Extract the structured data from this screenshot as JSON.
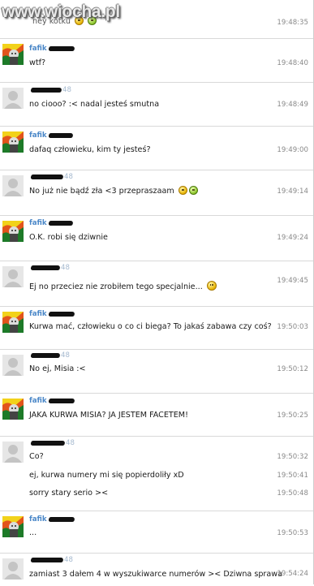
{
  "watermark": "www.wiocha.pl",
  "colors": {
    "username": "#4a87c8",
    "uid": "#a5b9cf",
    "timestamp": "#8a8a8a",
    "separator": "#d9d9d9"
  },
  "messages": [
    {
      "user": "fafik",
      "lines": [
        {
          "text": "wtf?",
          "time": "19:48:40"
        }
      ]
    },
    {
      "user": "",
      "uid": "48",
      "lines": [
        {
          "text": "no ciooo? :< nadal jesteś smutna",
          "time": "19:48:49"
        }
      ]
    },
    {
      "user": "fafik",
      "lines": [
        {
          "text": "dafaq człowieku, kim ty jesteś?",
          "time": "19:49:00"
        }
      ]
    },
    {
      "user": "",
      "uid": "48",
      "lines": [
        {
          "text": "No już nie bądź zła <3 przepraszaam",
          "time": "19:49:14",
          "emoji": [
            "smile-icon",
            "green-smile-icon"
          ]
        }
      ]
    },
    {
      "user": "fafik",
      "lines": [
        {
          "text": "O.K. robi się dziwnie",
          "time": "19:49:24"
        }
      ]
    },
    {
      "user": "",
      "uid": "48",
      "lines": [
        {
          "text": "Ej no przeciez nie zrobiłem tego specjalnie...",
          "time": "19:49:45",
          "emoji": [
            "smile-icon"
          ]
        }
      ]
    },
    {
      "user": "fafik",
      "lines": [
        {
          "text": "Kurwa mać, człowieku o co ci biega? To jakaś zabawa czy coś?",
          "time": "19:50:03"
        }
      ]
    },
    {
      "user": "",
      "uid": "48",
      "lines": [
        {
          "text": "No ej, Misia :<",
          "time": "19:50:12"
        }
      ]
    },
    {
      "user": "fafik",
      "lines": [
        {
          "text": "JAKA KURWA MISIA? JA JESTEM FACETEM!",
          "time": "19:50:25"
        }
      ]
    },
    {
      "user": "",
      "uid": "48",
      "lines": [
        {
          "text": "Co?",
          "time": "19:50:32"
        },
        {
          "text": "ej, kurwa numery mi się popierdoliły xD",
          "time": "19:50:41"
        },
        {
          "text": "sorry stary serio ><",
          "time": "19:50:48"
        }
      ]
    },
    {
      "user": "fafik",
      "lines": [
        {
          "text": "...",
          "time": "19:50:53"
        }
      ]
    },
    {
      "user": "",
      "uid": "48",
      "lines": [
        {
          "text": "zamiast 3 dałem 4 w wyszukiwarce numerów >< Dziwna sprawa",
          "time": "19:54:24"
        }
      ]
    }
  ],
  "top_partial": {
    "text": "ney kotku",
    "time": "19:48:35",
    "emoji": [
      "smile-icon",
      "green-smile-icon"
    ]
  }
}
